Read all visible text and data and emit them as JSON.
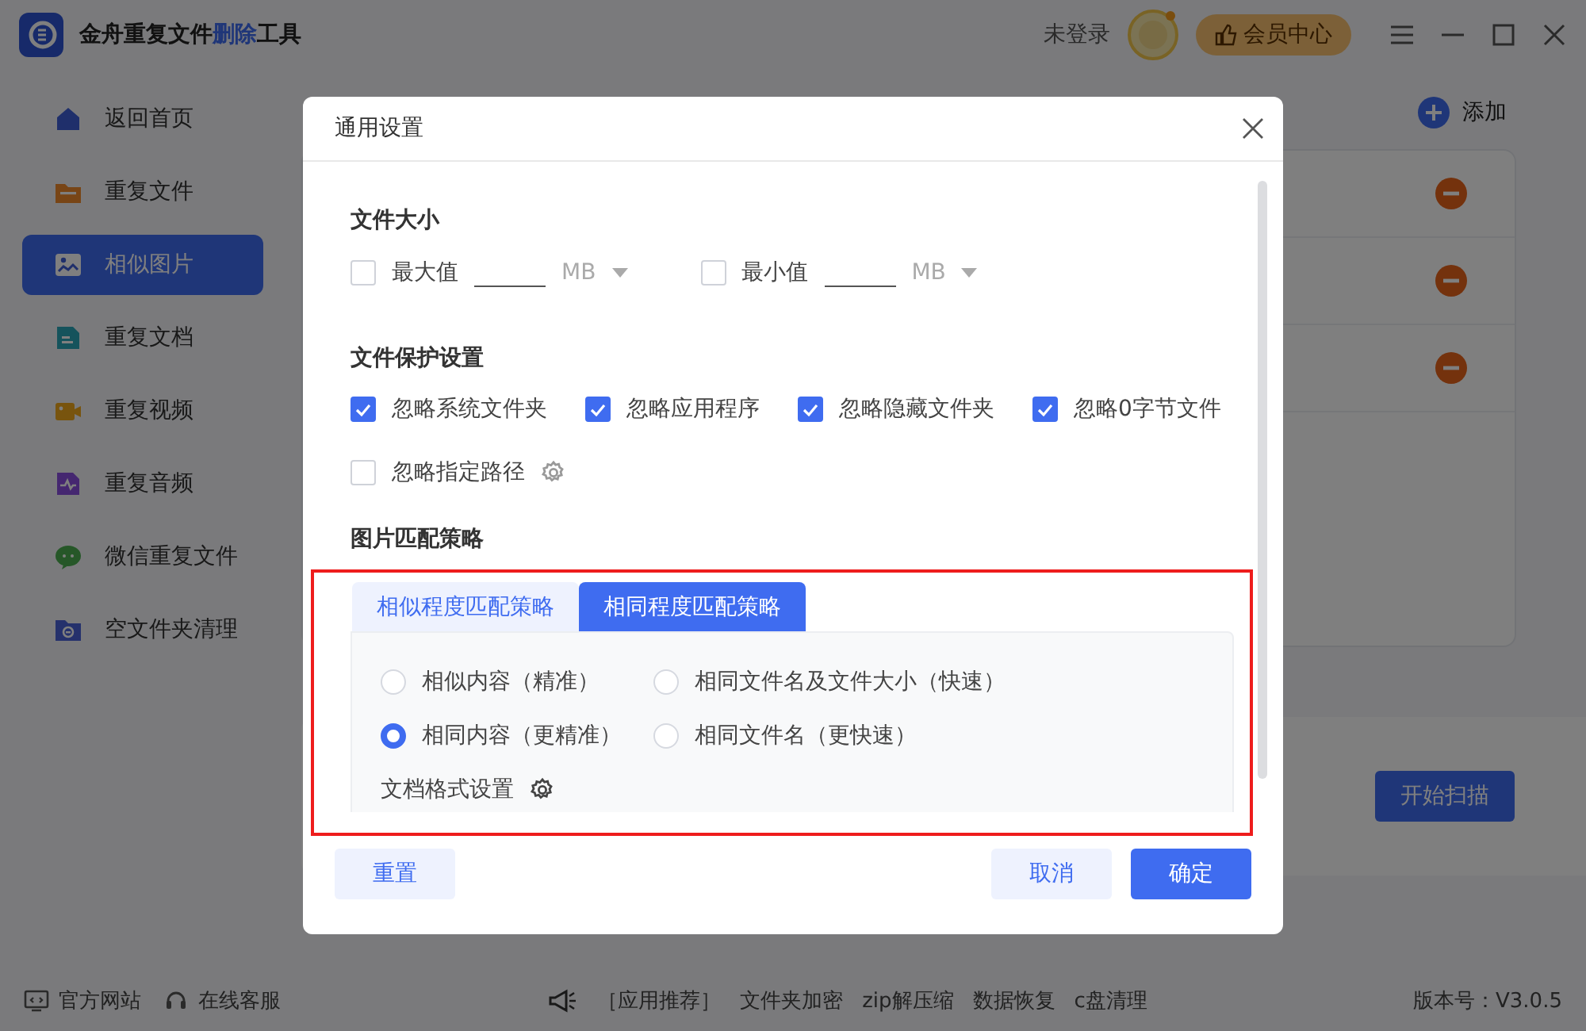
{
  "app": {
    "title_parts": [
      "金舟重复文件",
      "删除",
      "工具"
    ],
    "login": "未登录",
    "vip_button": "会员中心"
  },
  "sidebar": {
    "items": [
      {
        "label": "返回首页",
        "kind": "home",
        "selected": false
      },
      {
        "label": "重复文件",
        "kind": "folder",
        "selected": false
      },
      {
        "label": "相似图片",
        "kind": "image",
        "selected": true
      },
      {
        "label": "重复文档",
        "kind": "doc",
        "selected": false
      },
      {
        "label": "重复视频",
        "kind": "video",
        "selected": false
      },
      {
        "label": "重复音频",
        "kind": "audio",
        "selected": false
      },
      {
        "label": "微信重复文件",
        "kind": "chat",
        "selected": false
      },
      {
        "label": "空文件夹清理",
        "kind": "empty",
        "selected": false
      }
    ]
  },
  "main": {
    "add_button": "添加",
    "file_rows": [
      {
        "removable": true
      },
      {
        "removable": true
      },
      {
        "removable": true
      }
    ],
    "scan_button": "开始扫描"
  },
  "footer": {
    "links": [
      {
        "label": "官方网站",
        "kind": "monitor"
      },
      {
        "label": "在线客服",
        "kind": "headset"
      }
    ],
    "promo_label": "［应用推荐］",
    "promos": [
      "文件夹加密",
      "zip解压缩",
      "数据恢复",
      "c盘清理"
    ],
    "version": "版本号：V3.0.5"
  },
  "dialog": {
    "title": "通用设置",
    "file_size": {
      "heading": "文件大小",
      "limits": [
        {
          "label": "最大值",
          "checked": false,
          "unit": "MB"
        },
        {
          "label": "最小值",
          "checked": false,
          "unit": "MB"
        }
      ]
    },
    "protection": {
      "heading": "文件保护设置",
      "options": [
        {
          "label": "忽略系统文件夹",
          "checked": true,
          "has_settings": false
        },
        {
          "label": "忽略应用程序",
          "checked": true,
          "has_settings": false
        },
        {
          "label": "忽略隐藏文件夹",
          "checked": true,
          "has_settings": false
        },
        {
          "label": "忽略0字节文件",
          "checked": true,
          "has_settings": false
        },
        {
          "label": "忽略指定路径",
          "checked": false,
          "has_settings": true
        }
      ]
    },
    "match": {
      "heading": "图片匹配策略",
      "tabs": [
        {
          "label": "相似程度匹配策略",
          "selected": false
        },
        {
          "label": "相同程度匹配策略",
          "selected": true
        }
      ],
      "options": [
        {
          "label": "相似内容（精准）",
          "selected": false
        },
        {
          "label": "相同文件名及文件大小（快速）",
          "selected": false
        },
        {
          "label": "相同内容（更精准）",
          "selected": true
        },
        {
          "label": "相同文件名（更快速）",
          "selected": false
        }
      ],
      "format_settings": "文档格式设置"
    },
    "buttons": {
      "reset": "重置",
      "cancel": "取消",
      "ok": "确定"
    }
  }
}
